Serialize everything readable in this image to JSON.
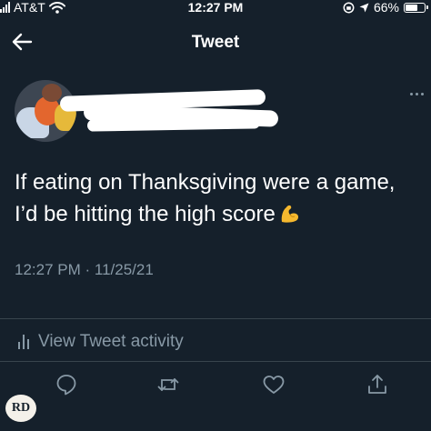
{
  "status_bar": {
    "carrier": "AT&T",
    "time": "12:27 PM",
    "battery": "66%",
    "battery_level": 0.66
  },
  "nav": {
    "title": "Tweet"
  },
  "tweet": {
    "text": "If eating on Thanksgiving were a game, I’d be hitting the high score",
    "timestamp": "12:27 PM · 11/25/21",
    "emoji_icon": "flexed-biceps-icon"
  },
  "activity": {
    "label": "View Tweet activity"
  },
  "actions": {
    "icons": [
      "reply-icon",
      "retweet-icon",
      "like-icon",
      "share-icon"
    ]
  },
  "watermark": {
    "text": "RD"
  },
  "colors": {
    "background": "#15202b",
    "muted_text": "#8899a6",
    "divider": "#38444d"
  }
}
